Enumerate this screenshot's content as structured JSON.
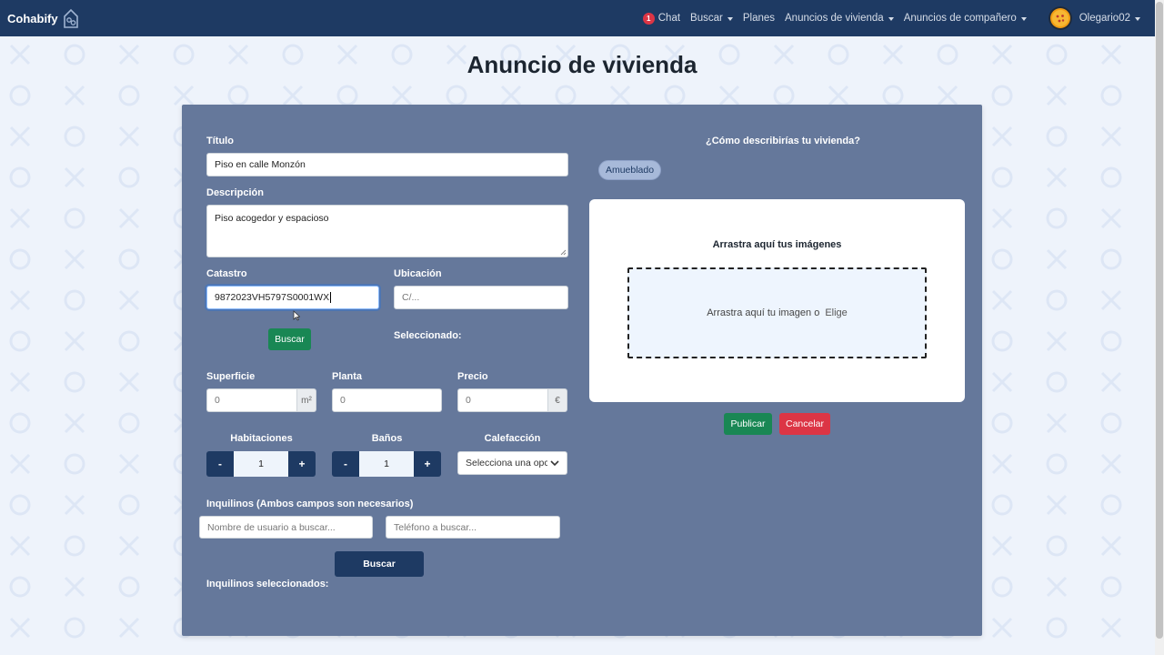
{
  "navbar": {
    "brand": "Cohabify",
    "chat_badge": "1",
    "chat": "Chat",
    "buscar": "Buscar",
    "planes": "Planes",
    "anuncios_vivienda": "Anuncios de vivienda",
    "anuncios_companero": "Anuncios de compañero",
    "username": "Olegario02"
  },
  "page": {
    "title": "Anuncio de vivienda"
  },
  "form": {
    "titulo_label": "Título",
    "titulo_value": "Piso en calle Monzón",
    "descripcion_label": "Descripción",
    "descripcion_value": "Piso acogedor y espacioso",
    "catastro_label": "Catastro",
    "catastro_value": "9872023VH5797S0001WX",
    "ubicacion_label": "Ubicación",
    "ubicacion_placeholder": "C/...",
    "buscar_button": "Buscar",
    "seleccionado_label": "Seleccionado:",
    "superficie_label": "Superficie",
    "superficie_placeholder": "0",
    "superficie_unit": "m²",
    "planta_label": "Planta",
    "planta_placeholder": "0",
    "precio_label": "Precio",
    "precio_placeholder": "0",
    "precio_unit": "€",
    "habitaciones_label": "Habitaciones",
    "habitaciones_value": "1",
    "banos_label": "Baños",
    "banos_value": "1",
    "minus": "-",
    "plus": "+",
    "calefaccion_label": "Calefacción",
    "calefaccion_selected": "Selecciona una opción",
    "inquilinos_label": "Inquilinos (Ambos campos son necesarios)",
    "usuario_placeholder": "Nombre de usuario a buscar...",
    "telefono_placeholder": "Teléfono a buscar...",
    "inquilinos_buscar_button": "Buscar",
    "inquilinos_seleccionados_label": "Inquilinos seleccionados:"
  },
  "right": {
    "describe_question": "¿Cómo describirías tu vivienda?",
    "tag": "Amueblado",
    "drop_title": "Arrastra aquí tus imágenes",
    "drop_text": "Arrastra aquí tu imagen o",
    "drop_link": "Elige",
    "publicar_button": "Publicar",
    "cancelar_button": "Cancelar"
  },
  "colors": {
    "navbar": "#1e3a63",
    "card": "#65789b",
    "green": "#198754",
    "red": "#dc3545",
    "background": "#eef3fb"
  }
}
